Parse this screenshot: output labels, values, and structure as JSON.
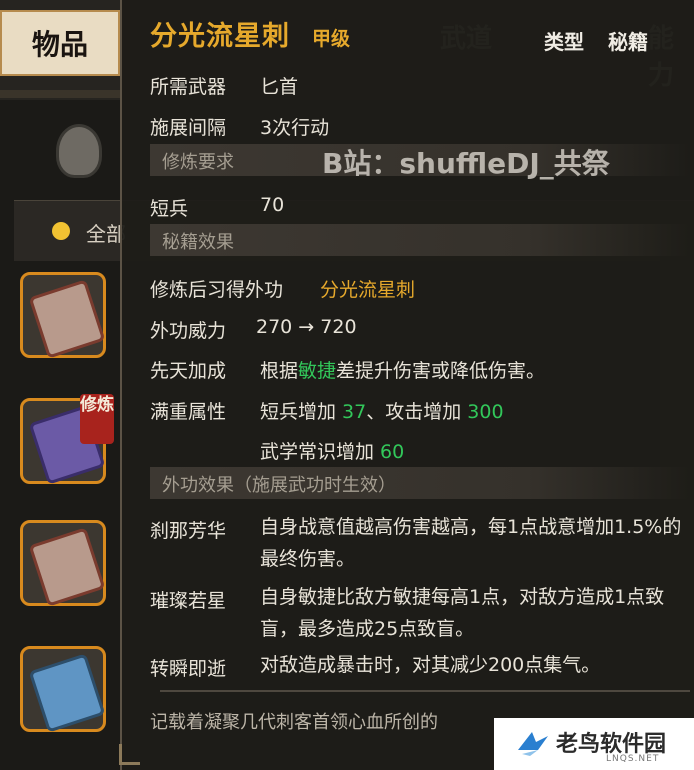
{
  "background": {
    "active_tab": "物品",
    "ghost_tabs": [
      "武道",
      "能力"
    ],
    "filter_all": "全部",
    "slot_badge": "修炼",
    "slot_books": [
      "red",
      "purple",
      "red",
      "blue"
    ]
  },
  "tooltip": {
    "title": "分光流星刺",
    "grade": "甲级",
    "type_label": "类型",
    "type_value": "秘籍",
    "watermark": "B站：shuffleDJ_共祭",
    "weapon_label": "所需武器",
    "weapon_value": "匕首",
    "interval_label": "施展间隔",
    "interval_value": "3次行动",
    "req_section": "修炼要求",
    "req_label": "短兵",
    "req_value": "70",
    "effect_section": "秘籍效果",
    "learn_label": "修炼后习得外功",
    "learn_value": "分光流星刺",
    "power_label": "外功威力",
    "power_value": "270 → 720",
    "innate_label": "先天加成",
    "innate_prefix": "根据",
    "innate_highlight": "敏捷",
    "innate_suffix": "差提升伤害或降低伤害。",
    "full_label": "满重属性",
    "full_line1_a": "短兵增加 ",
    "full_line1_b": "37",
    "full_line1_c": "、攻击增加 ",
    "full_line1_d": "300",
    "full_line2_a": "武学常识增加 ",
    "full_line2_b": "60",
    "ext_section": "外功效果（施展武功时生效）",
    "effects": [
      {
        "name": "刹那芳华",
        "text": "自身战意值越高伤害越高，每1点战意增加1.5%的最终伤害。"
      },
      {
        "name": "璀璨若星",
        "text": "自身敏捷比敌方敏捷每高1点，对敌方造成1点致盲，最多造成25点致盲。"
      },
      {
        "name": "转瞬即逝",
        "text": "对敌造成暴击时，对其减少200点集气。"
      }
    ],
    "footer": "记载着凝聚几代刺客首领心血所创的"
  },
  "logo": {
    "title": "老鸟软件园",
    "sub": "LNQS.NET"
  },
  "colors": {
    "accent_gold": "#e6a92c",
    "value_green": "#32c75a",
    "slot_border": "#d88a1e"
  }
}
